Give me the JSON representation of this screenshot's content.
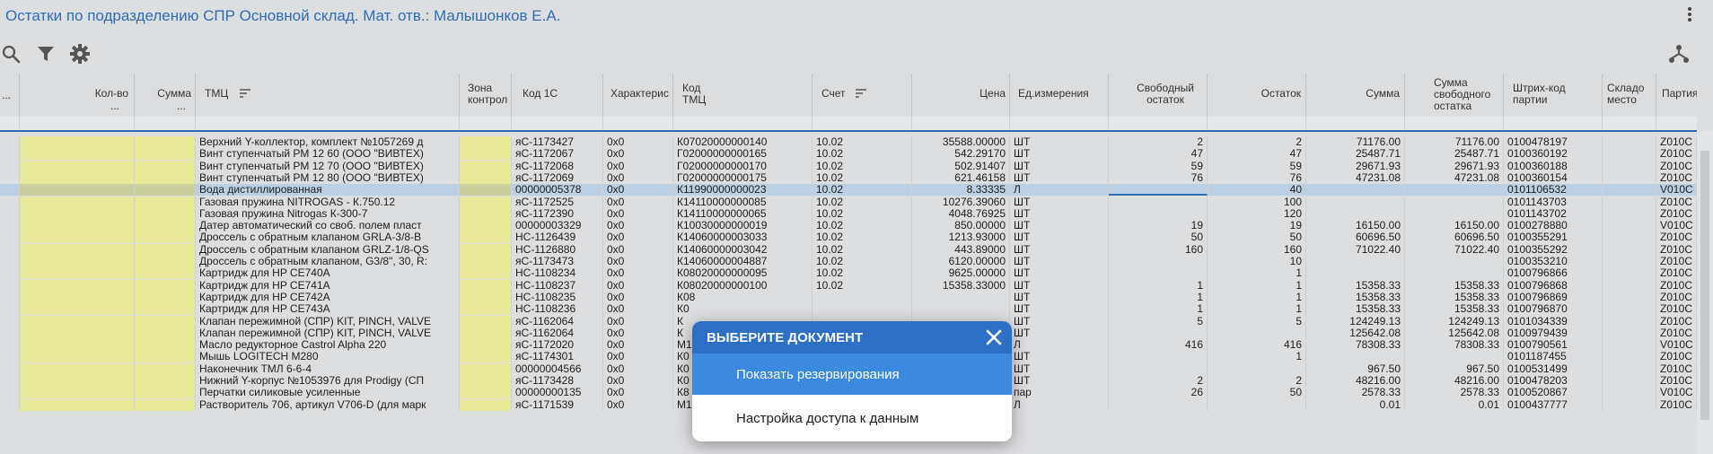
{
  "title": "Остатки по подразделению СПР Основной склад. Мат. отв.: Малышонков Е.А.",
  "toolbar": {
    "icons": [
      "search-icon",
      "filter-icon",
      "gear-icon",
      "hierarchy-icon"
    ]
  },
  "headers": {
    "dots_left": "...",
    "qty": "Кол-во",
    "qty_dots": "...",
    "sum": "Сумма",
    "sum_dots": "...",
    "tmc": "ТМЦ",
    "zone": "Зона контрол",
    "code1c": "Код 1С",
    "char": "Характерис",
    "codetmc": "Код ТМЦ",
    "account": "Счет",
    "price": "Цена",
    "unit": "Ед.измерения",
    "free": "Свободный остаток",
    "rest": "Остаток",
    "total": "Сумма",
    "freesum": "Сумма свободного остатка",
    "barcode": "Штрих-код партии",
    "place": "Складо место",
    "party": "Партия"
  },
  "colors": {
    "accent": "#2e6db4",
    "yellow": "#e8e89a",
    "selected_row": "#bcd0e3",
    "modal_header": "#2d6fc5",
    "modal_option_active": "#3b8ae0"
  },
  "rows": [
    {
      "tmc": "Верхний Y-коллектор, комплект №1057269 д",
      "code1c": "яС-1173427",
      "char": "0x0",
      "codetmc": "К07020000000140",
      "account": "10.02",
      "price": "35588.00000",
      "unit": "ШТ",
      "free": "2",
      "rest": "2",
      "sum": "71176.00",
      "freesum": "71176.00",
      "barcode": "0100478197",
      "party": "Z010С"
    },
    {
      "tmc": "Винт ступенчатый PM 12 60 (ООО \"ВИВТЕХ)",
      "code1c": "яС-1172067",
      "char": "0x0",
      "codetmc": "Г02000000000165",
      "account": "10.02",
      "price": "542.29170",
      "unit": "ШТ",
      "free": "47",
      "rest": "47",
      "sum": "25487.71",
      "freesum": "25487.71",
      "barcode": "0100360192",
      "party": "Z010С"
    },
    {
      "tmc": "Винт ступенчатый PM 12 70 (ООО \"ВИВТЕХ)",
      "code1c": "яС-1172068",
      "char": "0x0",
      "codetmc": "Г02000000000170",
      "account": "10.02",
      "price": "502.91407",
      "unit": "ШТ",
      "free": "59",
      "rest": "59",
      "sum": "29671.93",
      "freesum": "29671.93",
      "barcode": "0100360188",
      "party": "Z010С"
    },
    {
      "tmc": "Винт ступенчатый PM 12 80 (ООО \"ВИВТЕХ)",
      "code1c": "яС-1172069",
      "char": "0x0",
      "codetmc": "Г02000000000175",
      "account": "10.02",
      "price": "621.46158",
      "unit": "ШТ",
      "free": "76",
      "rest": "76",
      "sum": "47231.08",
      "freesum": "47231.08",
      "barcode": "0100360154",
      "party": "Z010С"
    },
    {
      "tmc": "Вода дистиллированная",
      "code1c": "00000005378",
      "char": "0x0",
      "codetmc": "К11990000000023",
      "account": "10.02",
      "price": "8.33335",
      "unit": "Л",
      "free": "",
      "rest": "40",
      "sum": "",
      "freesum": "",
      "barcode": "0101106532",
      "party": "V010С"
    },
    {
      "tmc": "Газовая пружина NITROGAS - К.750.12",
      "code1c": "яС-1172525",
      "char": "0x0",
      "codetmc": "К14110000000085",
      "account": "10.02",
      "price": "10276.39060",
      "unit": "ШТ",
      "free": "",
      "rest": "100",
      "sum": "",
      "freesum": "",
      "barcode": "0101143703",
      "party": "Z010С"
    },
    {
      "tmc": "Газовая пружина Nitrogas К-300-7",
      "code1c": "яС-1172390",
      "char": "0x0",
      "codetmc": "К14110000000065",
      "account": "10.02",
      "price": "4048.76925",
      "unit": "ШТ",
      "free": "",
      "rest": "120",
      "sum": "",
      "freesum": "",
      "barcode": "0101143702",
      "party": "Z010С"
    },
    {
      "tmc": "Датер автоматический со своб. полем пласт",
      "code1c": "00000003329",
      "char": "0x0",
      "codetmc": "К10030000000019",
      "account": "10.02",
      "price": "850.00000",
      "unit": "ШТ",
      "free": "19",
      "rest": "19",
      "sum": "16150.00",
      "freesum": "16150.00",
      "barcode": "0100278880",
      "party": "V010С"
    },
    {
      "tmc": "Дроссель с обратным клапаном GRLA-3/8-B",
      "code1c": "НС-1126439",
      "char": "0x0",
      "codetmc": "К14060000003033",
      "account": "10.02",
      "price": "1213.93000",
      "unit": "ШТ",
      "free": "50",
      "rest": "50",
      "sum": "60696.50",
      "freesum": "60696.50",
      "barcode": "0100355291",
      "party": "Z010С"
    },
    {
      "tmc": "Дроссель с обратным клапаном GRLZ-1/8-QS",
      "code1c": "НС-1126880",
      "char": "0x0",
      "codetmc": "К14060000003042",
      "account": "10.02",
      "price": "443.89000",
      "unit": "ШТ",
      "free": "160",
      "rest": "160",
      "sum": "71022.40",
      "freesum": "71022.40",
      "barcode": "0100355292",
      "party": "Z010С"
    },
    {
      "tmc": "Дроссель с обратным клапаном, G3/8\", 30, R:",
      "code1c": "яС-1173473",
      "char": "0x0",
      "codetmc": "К14060000004887",
      "account": "10.02",
      "price": "6120.00000",
      "unit": "ШТ",
      "free": "",
      "rest": "10",
      "sum": "",
      "freesum": "",
      "barcode": "0100353210",
      "party": "Z010С"
    },
    {
      "tmc": "Картридж для HP CE740A",
      "code1c": "НС-1108234",
      "char": "0x0",
      "codetmc": "К08020000000095",
      "account": "10.02",
      "price": "9625.00000",
      "unit": "ШТ",
      "free": "",
      "rest": "1",
      "sum": "",
      "freesum": "",
      "barcode": "0100796866",
      "party": "Z010С"
    },
    {
      "tmc": "Картридж для HP CE741A",
      "code1c": "НС-1108237",
      "char": "0x0",
      "codetmc": "К08020000000100",
      "account": "10.02",
      "price": "15358.33000",
      "unit": "ШТ",
      "free": "1",
      "rest": "1",
      "sum": "15358.33",
      "freesum": "15358.33",
      "barcode": "0100796868",
      "party": "Z010С"
    },
    {
      "tmc": "Картридж для HP CE742A",
      "code1c": "НС-1108235",
      "char": "0x0",
      "codetmc": "К08",
      "account": "",
      "price": "",
      "unit": "ШТ",
      "free": "1",
      "rest": "1",
      "sum": "15358.33",
      "freesum": "15358.33",
      "barcode": "0100796869",
      "party": "Z010С"
    },
    {
      "tmc": "Картридж для HP CE743A",
      "code1c": "НС-1108236",
      "char": "0x0",
      "codetmc": "К0",
      "account": "",
      "price": "",
      "unit": "ШТ",
      "free": "1",
      "rest": "1",
      "sum": "15358.33",
      "freesum": "15358.33",
      "barcode": "0100796870",
      "party": "Z010С"
    },
    {
      "tmc": "Клапан пережимной (СПР) KIT, PINCH, VALVE",
      "code1c": "яС-1162064",
      "char": "0x0",
      "codetmc": "К",
      "account": "",
      "price": "",
      "unit": "ШТ",
      "free": "5",
      "rest": "5",
      "sum": "124249.13",
      "freesum": "124249.13",
      "barcode": "0101034339",
      "party": "Z010С"
    },
    {
      "tmc": "Клапан пережимной (СПР) KIT, PINCH, VALVE",
      "code1c": "яС-1162064",
      "char": "0x0",
      "codetmc": "К",
      "account": "",
      "price": "",
      "unit": "ШТ",
      "free": "",
      "rest": "",
      "sum": "125642.08",
      "freesum": "125642.08",
      "barcode": "0100979439",
      "party": "Z010С"
    },
    {
      "tmc": "Масло редукторное Castrol Alpha 220",
      "code1c": "яС-1172020",
      "char": "0x0",
      "codetmc": "М1",
      "account": "",
      "price": "",
      "unit": "Л",
      "free": "416",
      "rest": "416",
      "sum": "78308.33",
      "freesum": "78308.33",
      "barcode": "0100790561",
      "party": "V010С"
    },
    {
      "tmc": "Мышь LOGITECH M280",
      "code1c": "яС-1174301",
      "char": "0x0",
      "codetmc": "К0",
      "account": "",
      "price": "",
      "unit": "ШТ",
      "free": "",
      "rest": "1",
      "sum": "",
      "freesum": "",
      "barcode": "0101187455",
      "party": "Z010С"
    },
    {
      "tmc": "Наконечник ТМЛ 6-6-4",
      "code1c": "00000004566",
      "char": "0x0",
      "codetmc": "К0",
      "account": "",
      "price": "",
      "unit": "ШТ",
      "free": "",
      "rest": "",
      "sum": "967.50",
      "freesum": "967.50",
      "barcode": "0100531499",
      "party": "Z010С"
    },
    {
      "tmc": "Нижний Y-корпус №1053976 для Prodigy (СП",
      "code1c": "яС-1173428",
      "char": "0x0",
      "codetmc": "К0",
      "account": "",
      "price": "",
      "unit": "ШТ",
      "free": "2",
      "rest": "2",
      "sum": "48216.00",
      "freesum": "48216.00",
      "barcode": "0100478203",
      "party": "Z010С"
    },
    {
      "tmc": "Перчатки силиковые усиленные",
      "code1c": "00000000135",
      "char": "0x0",
      "codetmc": "К8",
      "account": "",
      "price": "",
      "unit": "пар",
      "free": "26",
      "rest": "50",
      "sum": "2578.33",
      "freesum": "2578.33",
      "barcode": "0100520867",
      "party": "V010С"
    },
    {
      "tmc": "Растворитель 706, артикул V706-D (для марк",
      "code1c": "яС-1171539",
      "char": "0x0",
      "codetmc": "М16020000000017",
      "account": "10.02",
      "price": "4591.87556",
      "unit": "Л",
      "free": "",
      "rest": "",
      "sum": "0.01",
      "freesum": "0.01",
      "barcode": "0100437777",
      "party": "Z010С"
    }
  ],
  "modal": {
    "title": "ВЫБЕРИТЕ ДОКУМЕНТ",
    "options": [
      "Показать резервирования",
      "Настройка доступа к данным"
    ]
  }
}
